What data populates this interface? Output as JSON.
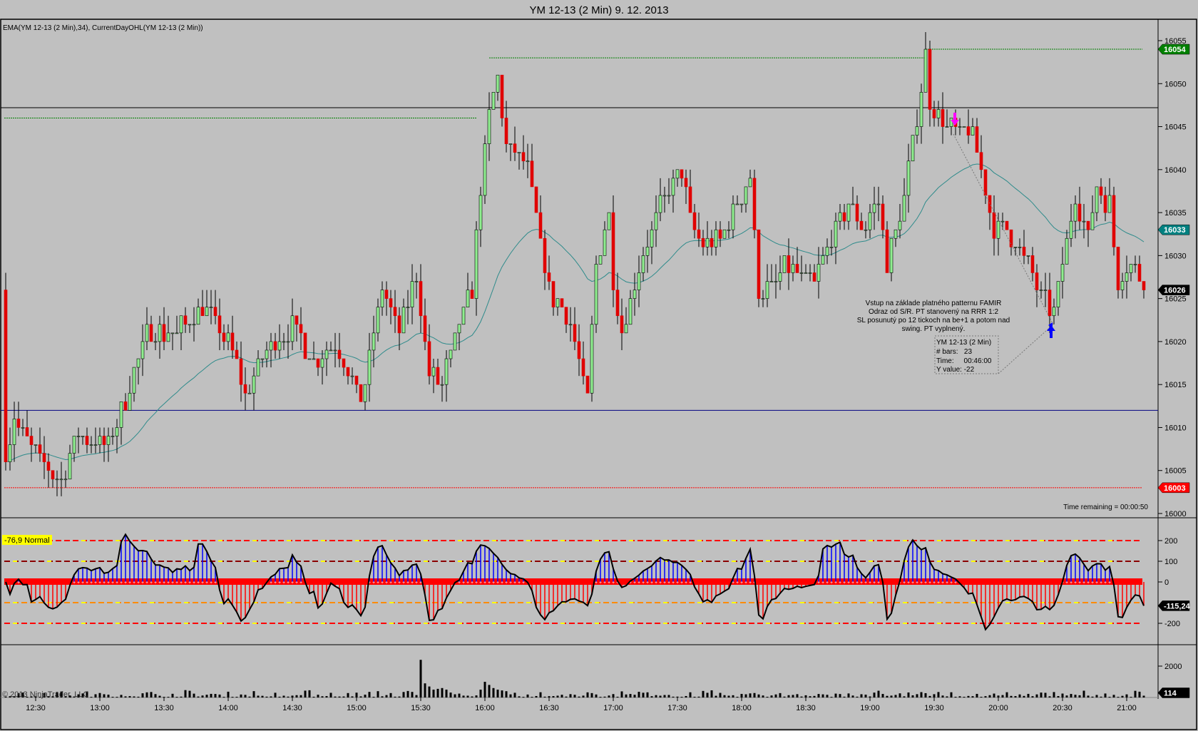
{
  "window": {
    "title": "YM 12-13 (2 Min)  9. 12. 2013"
  },
  "price_panel": {
    "indicator_label": "EMA(YM 12-13 (2 Min),34), CurrentDayOHL(YM 12-13 (2 Min))",
    "time_remaining": "Time remaining = 00:00:50",
    "annotation": [
      "Vstup na základe platného patternu FAMIR",
      "Odraz od S/R. PT stanovený na RRR 1:2",
      "SL posunutý po 12 tickoch na be+1 a potom nad",
      "swing. PT vyplnený."
    ],
    "measure_tooltip": [
      "YM 12-13 (2 Min)",
      "# bars:   23",
      "Time:     00:46:00",
      "Y value: -22"
    ],
    "tags": [
      {
        "label": "16054",
        "value": 16054,
        "color": "#008000"
      },
      {
        "label": "16033",
        "value": 16033,
        "color": "#008080"
      },
      {
        "label": "16026",
        "value": 16026,
        "color": "#000000"
      },
      {
        "label": "16003",
        "value": 16003,
        "color": "#ff0000"
      }
    ],
    "colors": {
      "up": "#90ee90",
      "down": "#e00000",
      "ema": "#2e8b8b"
    }
  },
  "oscillator_panel": {
    "label": "-76,9 Normal",
    "ticks": [
      "200",
      "100",
      "0",
      "-200"
    ],
    "tick_values": [
      200,
      100,
      0,
      -200
    ],
    "tag": {
      "label": "-115,24",
      "value": -115.24
    }
  },
  "volume_panel": {
    "copyright": "© 2013 NinjaTrader, LLC",
    "ticks": [
      "2000"
    ],
    "tick_values": [
      2000
    ],
    "tag": {
      "label": "114",
      "value": 114
    }
  },
  "chart_data": {
    "type": "candlestick",
    "title": "YM 12-13 (2 Min)  9. 12. 2013",
    "bar_minutes": 2,
    "x_ticks": [
      "12:30",
      "13:00",
      "13:30",
      "14:00",
      "14:30",
      "15:00",
      "15:30",
      "16:00",
      "16:30",
      "17:00",
      "17:30",
      "18:00",
      "18:30",
      "19:00",
      "19:30",
      "20:00",
      "20:30",
      "21:00"
    ],
    "y_ticks": [
      "16000",
      "16005",
      "16010",
      "16015",
      "16020",
      "16025",
      "16030",
      "16035",
      "16040",
      "16045",
      "16050",
      "16055"
    ],
    "y_range": [
      16000,
      16055
    ],
    "close_path_minutes_from_1230_price": [
      [
        -14,
        16007
      ],
      [
        -10,
        16011
      ],
      [
        2,
        16006
      ],
      [
        12,
        16004
      ],
      [
        20,
        16009
      ],
      [
        34,
        16008
      ],
      [
        40,
        16012
      ],
      [
        52,
        16021
      ],
      [
        66,
        16021
      ],
      [
        78,
        16024
      ],
      [
        90,
        16020
      ],
      [
        98,
        16014
      ],
      [
        106,
        16018
      ],
      [
        120,
        16022
      ],
      [
        130,
        16018
      ],
      [
        140,
        16020
      ],
      [
        152,
        16013
      ],
      [
        158,
        16021
      ],
      [
        162,
        16026
      ],
      [
        170,
        16021
      ],
      [
        178,
        16028
      ],
      [
        184,
        16016
      ],
      [
        190,
        16015
      ],
      [
        198,
        16022
      ],
      [
        204,
        16026
      ],
      [
        208,
        16038
      ],
      [
        212,
        16046
      ],
      [
        216,
        16051
      ],
      [
        220,
        16043
      ],
      [
        230,
        16040
      ],
      [
        234,
        16034
      ],
      [
        240,
        16026
      ],
      [
        250,
        16022
      ],
      [
        258,
        16013
      ],
      [
        262,
        16029
      ],
      [
        268,
        16035
      ],
      [
        270,
        16027
      ],
      [
        274,
        16021
      ],
      [
        282,
        16029
      ],
      [
        288,
        16033
      ],
      [
        296,
        16038
      ],
      [
        302,
        16040
      ],
      [
        306,
        16034
      ],
      [
        312,
        16031
      ],
      [
        320,
        16032
      ],
      [
        330,
        16037
      ],
      [
        334,
        16039
      ],
      [
        338,
        16026
      ],
      [
        344,
        16026
      ],
      [
        350,
        16029
      ],
      [
        358,
        16027
      ],
      [
        364,
        16027
      ],
      [
        370,
        16031
      ],
      [
        380,
        16036
      ],
      [
        386,
        16033
      ],
      [
        394,
        16036
      ],
      [
        398,
        16029
      ],
      [
        406,
        16037
      ],
      [
        412,
        16046
      ],
      [
        416,
        16053
      ],
      [
        418,
        16048
      ],
      [
        426,
        16045
      ],
      [
        432,
        16044
      ],
      [
        436,
        16045
      ],
      [
        442,
        16040
      ],
      [
        448,
        16033
      ],
      [
        454,
        16033
      ],
      [
        460,
        16031
      ],
      [
        470,
        16025
      ],
      [
        476,
        16023
      ],
      [
        482,
        16032
      ],
      [
        486,
        16037
      ],
      [
        492,
        16032
      ],
      [
        496,
        16038
      ],
      [
        502,
        16036
      ],
      [
        506,
        16027
      ],
      [
        512,
        16029
      ],
      [
        518,
        16026
      ]
    ],
    "horizontal_lines": [
      {
        "name": "prior-day-high",
        "value": 16046,
        "color": "#008000"
      },
      {
        "name": "current-day-high-1",
        "value": 16053,
        "color": "#008000"
      },
      {
        "name": "current-day-high",
        "value": 16054,
        "color": "#008000"
      },
      {
        "name": "resistance-line",
        "value": 16047.2,
        "color": "#000000"
      },
      {
        "name": "support-line",
        "value": 16012,
        "color": "#000080"
      },
      {
        "name": "current-day-low",
        "value": 16003,
        "color": "#ff0000"
      }
    ],
    "volume_spikes_minutes_value": [
      [
        180,
        2400
      ],
      [
        182,
        900
      ],
      [
        184,
        700
      ],
      [
        186,
        500
      ],
      [
        188,
        550
      ],
      [
        190,
        600
      ],
      [
        192,
        500
      ],
      [
        208,
        500
      ],
      [
        210,
        1000
      ],
      [
        212,
        800
      ],
      [
        214,
        600
      ],
      [
        216,
        500
      ],
      [
        218,
        450
      ],
      [
        220,
        400
      ]
    ],
    "ema_period": 34
  }
}
